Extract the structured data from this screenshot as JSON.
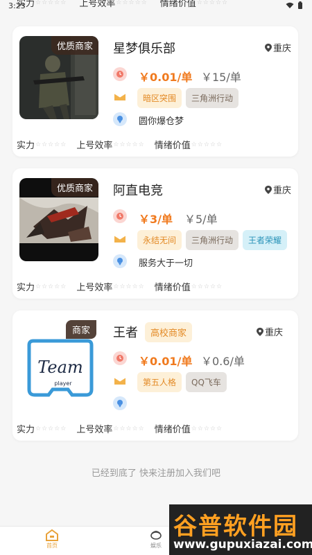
{
  "status": {
    "time": "3:23"
  },
  "partial_card": {
    "stats": [
      "实力",
      "上号效率",
      "情绪价值"
    ]
  },
  "cards": [
    {
      "badge": "优质商家",
      "name": "星梦俱乐部",
      "city": "重庆",
      "price": "￥0.01/单",
      "old_price": "￥15/单",
      "games": [
        "暗区突围",
        "三角洲行动"
      ],
      "slogan": "圆你爆仓梦",
      "stats": [
        "实力",
        "上号效率",
        "情绪价值"
      ]
    },
    {
      "badge": "优质商家",
      "name": "阿直电竞",
      "city": "重庆",
      "price": "￥3/单",
      "old_price": "￥5/单",
      "games": [
        "永结无间",
        "三角洲行动",
        "王者荣耀"
      ],
      "slogan": "服务大于一切",
      "stats": [
        "实力",
        "上号效率",
        "情绪价值"
      ]
    },
    {
      "badge": "商家",
      "name": "王者",
      "school_tag": "高校商家",
      "city": "重庆",
      "price": "￥0.01/单",
      "old_price": "￥0.6/单",
      "games": [
        "第五人格",
        "QQ飞车"
      ],
      "logo_text": "Team",
      "logo_subtext": "player",
      "stats": [
        "实力",
        "上号效率",
        "情绪价值"
      ]
    }
  ],
  "list_end": "已经到底了 快来注册加入我们吧",
  "nav": {
    "home": "首页",
    "entertainment": "娱乐"
  },
  "watermark": {
    "main": "谷普软件园",
    "url": "www.gupuxiazai.com"
  },
  "colors": {
    "price": "#f07a1e",
    "nav_active": "#e8a23a"
  }
}
